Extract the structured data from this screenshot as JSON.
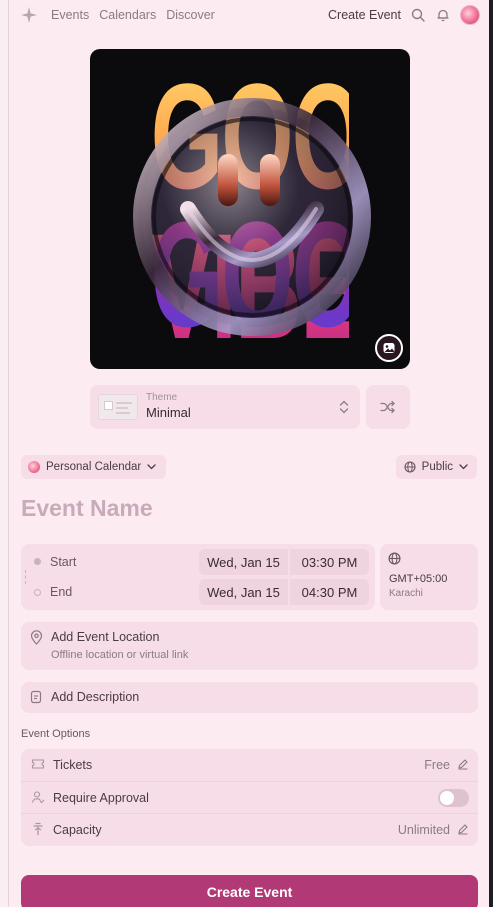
{
  "nav": {
    "logo_icon": "sparkle-icon",
    "links": [
      "Events",
      "Calendars",
      "Discover"
    ],
    "create_label": "Create Event",
    "icons": [
      "search-icon",
      "bell-icon",
      "avatar"
    ]
  },
  "cover": {
    "title_top": "GOOD VIBES",
    "title_bottom": "GOOD VIBES",
    "change_icon": "image-icon"
  },
  "theme": {
    "label": "Theme",
    "value": "Minimal",
    "shuffle_icon": "shuffle-icon"
  },
  "calendar": {
    "label": "Personal Calendar"
  },
  "visibility": {
    "label": "Public"
  },
  "event_name": {
    "placeholder": "Event Name"
  },
  "datetime": {
    "start_label": "Start",
    "start_date": "Wed, Jan 15",
    "start_time": "03:30 PM",
    "end_label": "End",
    "end_date": "Wed, Jan 15",
    "end_time": "04:30 PM",
    "timezone_offset": "GMT+05:00",
    "timezone_city": "Karachi"
  },
  "location": {
    "title": "Add Event Location",
    "subtitle": "Offline location or virtual link"
  },
  "description": {
    "title": "Add Description"
  },
  "options": {
    "heading": "Event Options",
    "tickets_label": "Tickets",
    "tickets_value": "Free",
    "approval_label": "Require Approval",
    "approval_on": false,
    "capacity_label": "Capacity",
    "capacity_value": "Unlimited"
  },
  "submit": {
    "label": "Create Event"
  },
  "colors": {
    "accent": "#b13a76",
    "background": "#fdebf2",
    "panel": "#f6dde7"
  }
}
